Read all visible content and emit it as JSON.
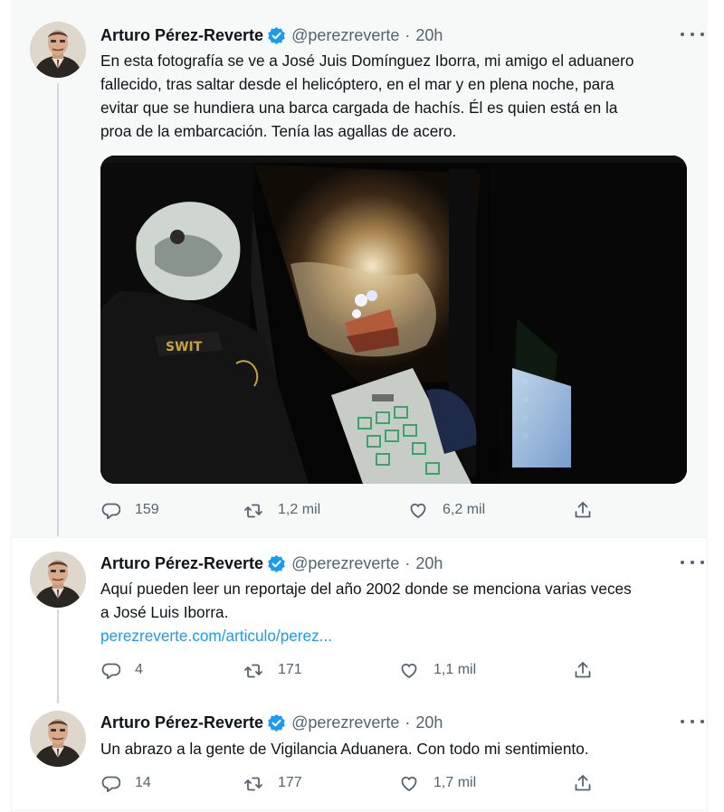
{
  "author": {
    "name": "Arturo Pérez-Reverte",
    "handle": "@perezreverte",
    "separator": "·"
  },
  "tweets": [
    {
      "time": "20h",
      "text_lines": [
        "En esta fotografía se ve a José Juis Domínguez Iborra, mi amigo el aduanero",
        "fallecido, tras saltar desde el helicóptero, en el mar y en plena noche, para",
        "evitar que se hundiera una barca cargada de hachís. Él es quien está en la",
        "proa de la embarcación. Tenía las agallas de acero."
      ],
      "media_text": "SWIT",
      "replies": "159",
      "retweets": "1,2 mil",
      "likes": "6,2 mil"
    },
    {
      "time": "20h",
      "text_lines": [
        "Aquí pueden leer un reportaje del año 2002 donde se menciona varias veces",
        "a José Luis Iborra."
      ],
      "link": "perezreverte.com/articulo/perez...",
      "replies": "4",
      "retweets": "171",
      "likes": "1,1 mil"
    },
    {
      "time": "20h",
      "text_lines": [
        "Un abrazo a la gente de Vigilancia Aduanera. Con todo mi sentimiento."
      ],
      "replies": "14",
      "retweets": "177",
      "likes": "1,7 mil"
    }
  ],
  "colors": {
    "verified": "#1d9bf0",
    "link": "#1d9bf0",
    "icon_gray": "#536471",
    "thread_line": "#cfd9de",
    "highlight_bg": "#f7f9f9"
  },
  "icons": {
    "reply": "reply-icon",
    "retweet": "retweet-icon",
    "like": "like-icon",
    "share": "share-icon",
    "more": "more-icon",
    "verified": "verified-icon"
  }
}
